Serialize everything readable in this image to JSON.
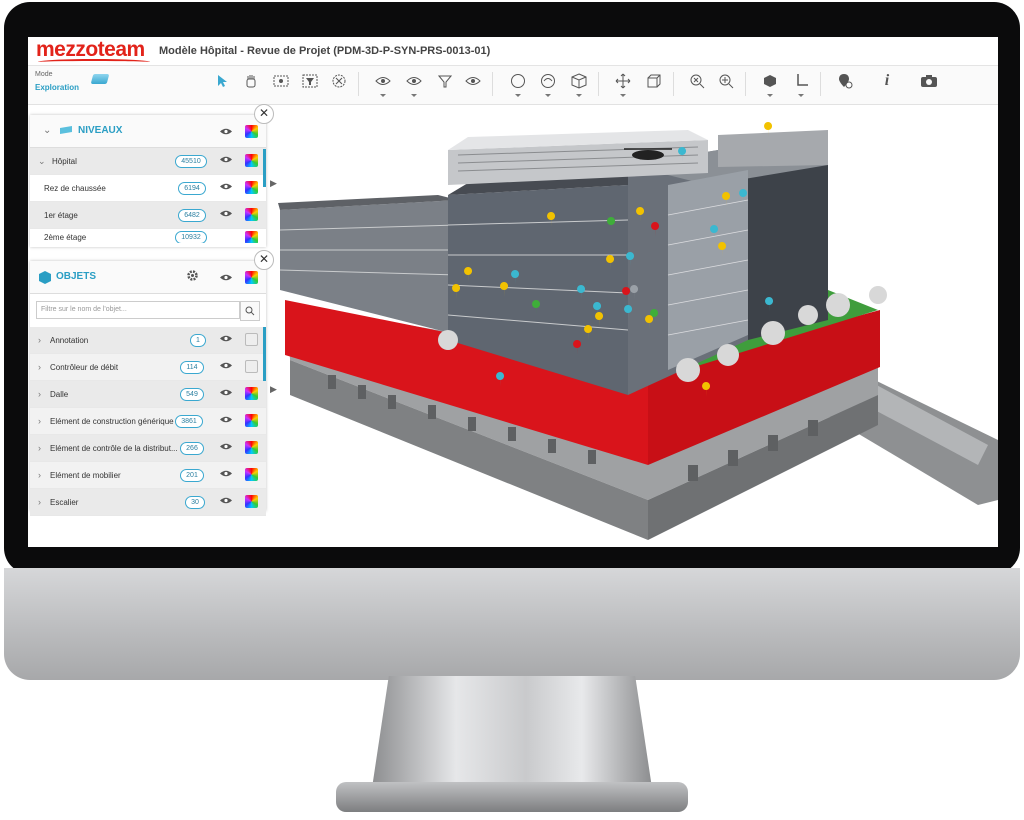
{
  "app": {
    "logo": "mezzoteam",
    "title": "Modèle Hôpital - Revue de Projet (PDM-3D-P-SYN-PRS-0013-01)"
  },
  "toolbar": {
    "mode_label": "Mode",
    "mode_value": "Exploration",
    "info_glyph": "i"
  },
  "niveaux": {
    "title": "NIVEAUX",
    "items": [
      {
        "label": "Hôpital",
        "count": "45510"
      },
      {
        "label": "Rez de chaussée",
        "count": "6194"
      },
      {
        "label": "1er étage",
        "count": "6482"
      },
      {
        "label": "2ème étage",
        "count": "10932"
      }
    ]
  },
  "objets": {
    "title": "OBJETS",
    "filter_placeholder": "Filtre sur le nom de l'objet...",
    "items": [
      {
        "label": "Annotation",
        "count": "1"
      },
      {
        "label": "Contrôleur de débit",
        "count": "114"
      },
      {
        "label": "Dalle",
        "count": "549"
      },
      {
        "label": "Elément de construction générique",
        "count": "3861"
      },
      {
        "label": "Elément de contrôle de la distribut...",
        "count": "266"
      },
      {
        "label": "Elément de mobilier",
        "count": "201"
      },
      {
        "label": "Escalier",
        "count": "30"
      }
    ]
  },
  "colors": {
    "brand": "#e2231a",
    "accent": "#2a9ec4",
    "facade_red": "#d9141b"
  },
  "icons": [
    "select-icon",
    "hand-icon",
    "xray-icon",
    "filter-icon",
    "clear-icon",
    "hide-icon",
    "show-icon",
    "isolate-icon",
    "eye-icon",
    "sphere-icon",
    "rotate-icon",
    "cube-icon",
    "move-icon",
    "box-icon",
    "zoom-fit-icon",
    "zoom-in-icon",
    "section-icon",
    "measure-icon",
    "pin-icon",
    "info-icon",
    "camera-icon"
  ]
}
